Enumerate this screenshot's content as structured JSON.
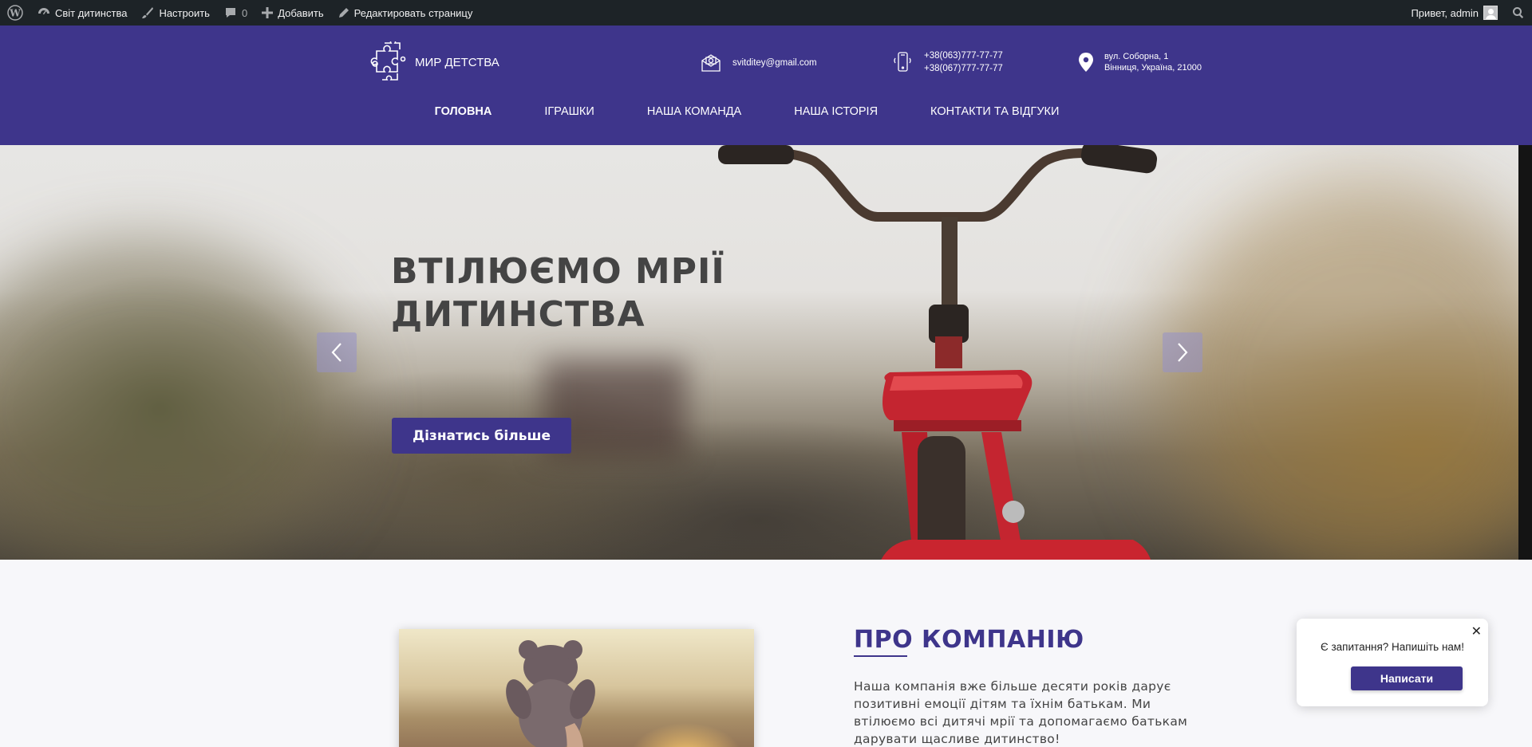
{
  "admin_bar": {
    "site_name": "Світ дитинства",
    "customize": "Настроить",
    "comments_count": "0",
    "add_new": "Добавить",
    "edit_page": "Редактировать страницу",
    "greeting": "Привет, admin"
  },
  "header": {
    "logo_text": "МИР ДЕТСТВА",
    "email": "svitditey@gmail.com",
    "phone_1": "+38(063)777-77-77",
    "phone_2": "+38(067)777-77-77",
    "address_1": "вул. Соборна, 1",
    "address_2": "Вінниця, Україна, 21000"
  },
  "nav": {
    "items": [
      {
        "label": "ГОЛОВНА",
        "active": true
      },
      {
        "label": "ІГРАШКИ"
      },
      {
        "label": "НАША КОМАНДА"
      },
      {
        "label": "НАША ІСТОРІЯ"
      },
      {
        "label": "КОНТАКТИ ТА ВІДГУКИ"
      }
    ]
  },
  "hero": {
    "title_line1": "ВТІЛЮЄМО МРІЇ",
    "title_line2": "ДИТИНСТВА",
    "button_label": "Дізнатись більше"
  },
  "about": {
    "title": "ПРО КОМПАНІЮ",
    "text": "Наша компанія вже більше десяти років дарує позитивні емоції дітям та їхнім батькам. Ми втілюємо всі дитячі мрії та допомагаємо батькам дарувати щасливе дитинство!"
  },
  "chat": {
    "question": "Є запитання? Напишіть нам!",
    "button_label": "Написати",
    "close": "✕"
  },
  "colors": {
    "brand": "#3e358b",
    "admin_bar": "#1d2327"
  }
}
